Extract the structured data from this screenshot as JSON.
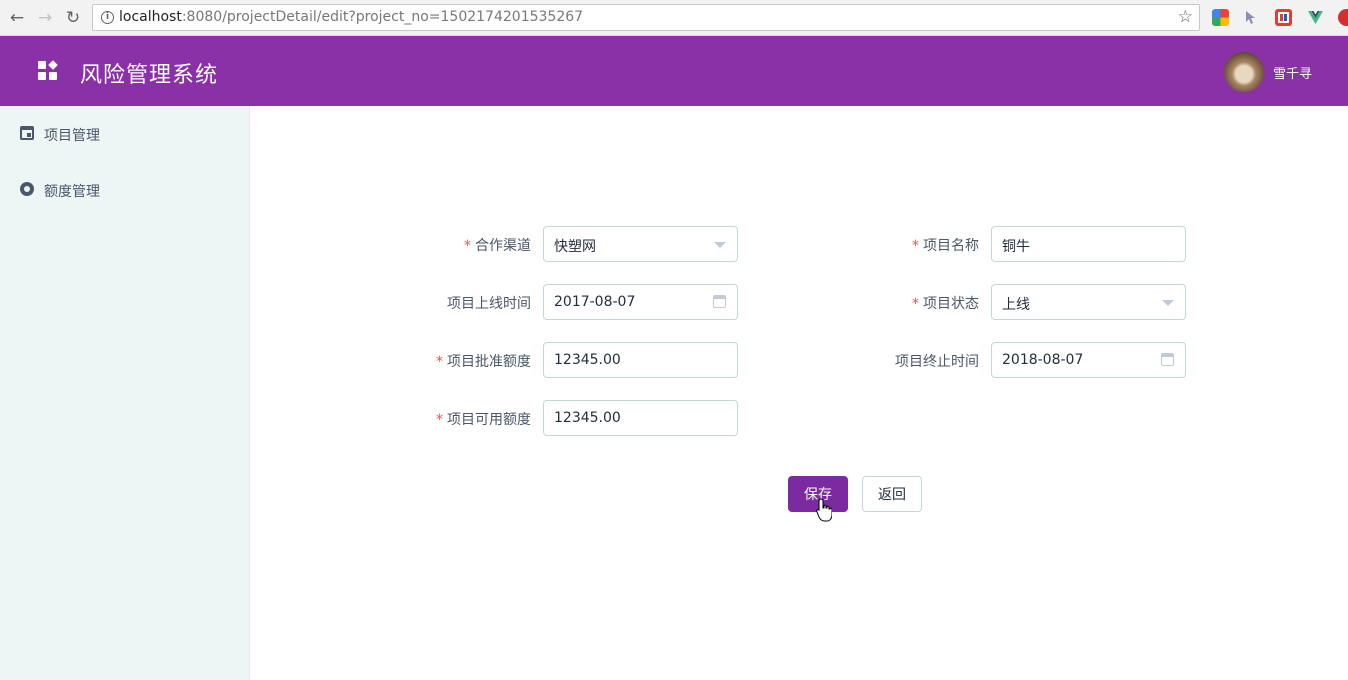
{
  "browser": {
    "url_host": "localhost",
    "url_path": ":8080/projectDetail/edit?project_no=1502174201535267"
  },
  "app": {
    "title": "风险管理系统",
    "user_name": "雪千寻"
  },
  "sidebar": {
    "items": [
      {
        "label": "项目管理",
        "icon": "calendar-icon"
      },
      {
        "label": "额度管理",
        "icon": "gear-icon"
      }
    ]
  },
  "form": {
    "channel": {
      "label": "合作渠道",
      "required": true,
      "value": "快塑网"
    },
    "project_name": {
      "label": "项目名称",
      "required": true,
      "value": "铜牛"
    },
    "launch_date": {
      "label": "项目上线时间",
      "required": false,
      "value": "2017-08-07"
    },
    "status": {
      "label": "项目状态",
      "required": true,
      "value": "上线"
    },
    "approved_amount": {
      "label": "项目批准额度",
      "required": true,
      "value": "12345.00"
    },
    "end_date": {
      "label": "项目终止时间",
      "required": false,
      "value": "2018-08-07"
    },
    "available_amount": {
      "label": "项目可用额度",
      "required": true,
      "value": "12345.00"
    },
    "required_mark": "*"
  },
  "actions": {
    "save_label": "保存",
    "back_label": "返回"
  },
  "colors": {
    "brand": "#8b31a8",
    "primary_button": "#7b2aa0",
    "sidebar_bg": "#eef6f5",
    "required": "#ff4949"
  }
}
